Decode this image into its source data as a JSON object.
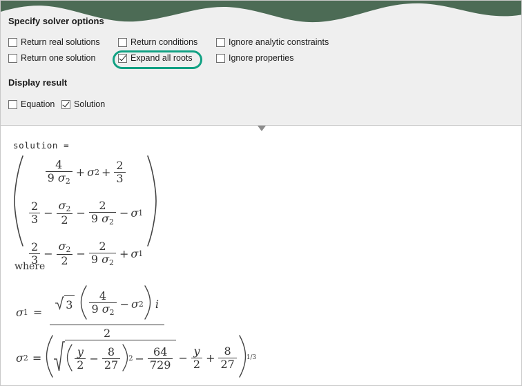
{
  "window": {
    "top_strip_masked": true,
    "mask_color": "#4c6b55"
  },
  "solver_options": {
    "title": "Specify solver options",
    "checkboxes": [
      {
        "label": "Return real solutions",
        "checked": false,
        "name": "return-real-solutions"
      },
      {
        "label": "Return conditions",
        "checked": false,
        "name": "return-conditions"
      },
      {
        "label": "Ignore analytic constraints",
        "checked": false,
        "name": "ignore-analytic-constraints"
      },
      {
        "label": "Return one solution",
        "checked": false,
        "name": "return-one-solution"
      },
      {
        "label": "Expand all roots",
        "checked": true,
        "name": "expand-all-roots"
      },
      {
        "label": "Ignore properties",
        "checked": false,
        "name": "ignore-properties"
      }
    ]
  },
  "display_result": {
    "title": "Display result",
    "checkboxes": [
      {
        "label": "Equation",
        "checked": false,
        "name": "display-equation"
      },
      {
        "label": "Solution",
        "checked": true,
        "name": "display-solution"
      }
    ]
  },
  "highlight": {
    "target_label": "Expand all roots",
    "color": "#11a183"
  },
  "collapse_control": {
    "glyph": "▼",
    "name": "collapse-panel-chevron"
  },
  "result": {
    "variable_label": "solution =",
    "where_label": "where",
    "matrix": {
      "rows": [
        {
          "terms": [
            {
              "type": "frac",
              "num": "4",
              "den_coef": "9",
              "den_sym": "σ",
              "den_sub": "2"
            },
            {
              "type": "op",
              "text": "+"
            },
            {
              "type": "sym",
              "sym": "σ",
              "sub": "2"
            },
            {
              "type": "op",
              "text": "+"
            },
            {
              "type": "frac",
              "num": "2",
              "den": "3"
            }
          ]
        },
        {
          "terms": [
            {
              "type": "frac",
              "num": "2",
              "den": "3"
            },
            {
              "type": "op",
              "text": "−"
            },
            {
              "type": "frac",
              "num_sym": "σ",
              "num_sub": "2",
              "den": "2"
            },
            {
              "type": "op",
              "text": "−"
            },
            {
              "type": "frac",
              "num": "2",
              "den_coef": "9",
              "den_sym": "σ",
              "den_sub": "2"
            },
            {
              "type": "op",
              "text": "−"
            },
            {
              "type": "sym",
              "sym": "σ",
              "sub": "1"
            }
          ]
        },
        {
          "terms": [
            {
              "type": "frac",
              "num": "2",
              "den": "3"
            },
            {
              "type": "op",
              "text": "−"
            },
            {
              "type": "frac",
              "num_sym": "σ",
              "num_sub": "2",
              "den": "2"
            },
            {
              "type": "op",
              "text": "−"
            },
            {
              "type": "frac",
              "num": "2",
              "den_coef": "9",
              "den_sym": "σ",
              "den_sub": "2"
            },
            {
              "type": "op",
              "text": "+"
            },
            {
              "type": "sym",
              "sym": "σ",
              "sub": "1"
            }
          ]
        }
      ]
    },
    "sigma1": {
      "lhs_sym": "σ",
      "lhs_sub": "1",
      "equals": "=",
      "numerator": {
        "sqrt_radicand": "3",
        "paren_open": "(",
        "inner_frac_num": "4",
        "inner_frac_den_coef": "9",
        "inner_frac_den_sym": "σ",
        "inner_frac_den_sub": "2",
        "inner_op": "−",
        "inner_sym": "σ",
        "inner_sub": "2",
        "paren_close": ")",
        "imaginary": "i"
      },
      "denominator": "2"
    },
    "sigma2": {
      "lhs_sym": "σ",
      "lhs_sub": "2",
      "equals": "=",
      "paren_open": "(",
      "sqrt": {
        "g_paren_open": "(",
        "f1_num": "y",
        "f1_den": "2",
        "op1": "−",
        "f2_num": "8",
        "f2_den": "27",
        "g_paren_close": ")",
        "g_power": "2",
        "op2": "−",
        "f3_num": "64",
        "f3_den": "729"
      },
      "op3": "−",
      "f4_num": "y",
      "f4_den": "2",
      "op4": "+",
      "f5_num": "8",
      "f5_den": "27",
      "paren_close": ")",
      "exponent": "1/3"
    }
  }
}
